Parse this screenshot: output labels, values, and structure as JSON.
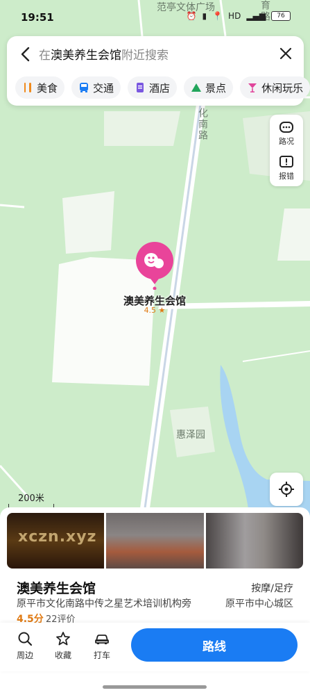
{
  "status_bar": {
    "time": "19:51",
    "battery": "76",
    "network": "HD"
  },
  "search": {
    "prefix": "在",
    "place": "澳美养生会馆",
    "suffix": "附近搜索"
  },
  "categories": [
    {
      "label": "美食",
      "icon": "fork-knife-icon",
      "color": "#f08a1c"
    },
    {
      "label": "交通",
      "icon": "bus-icon",
      "color": "#1a7cf3"
    },
    {
      "label": "酒店",
      "icon": "hotel-icon",
      "color": "#7a57e0"
    },
    {
      "label": "景点",
      "icon": "mountain-icon",
      "color": "#22a55b"
    },
    {
      "label": "休闲玩乐",
      "icon": "cocktail-icon",
      "color": "#e0459b"
    }
  ],
  "map": {
    "top_label": "范亭文体广场",
    "top_road_right": "育路",
    "road_label": "化南路",
    "park_label": "惠泽园",
    "scale": "200米"
  },
  "side_buttons": {
    "traffic": "路况",
    "report": "报错"
  },
  "poi": {
    "name": "澳美养生会馆",
    "rating": "4.5 ★"
  },
  "photos": {
    "overlay_text": "xczn.xyz"
  },
  "shop": {
    "name": "澳美养生会馆",
    "category": "按摩/足疗",
    "address": "原平市文化南路中传之星艺术培训机构旁",
    "area": "原平市中心城区",
    "score": "4.5分",
    "reviews": "22评价"
  },
  "actions": {
    "nearby": "周边",
    "favorite": "收藏",
    "taxi": "打车",
    "route": "路线"
  },
  "colors": {
    "accent": "#1a7cf3",
    "marker": "#e9449a",
    "rating": "#e07b15"
  }
}
